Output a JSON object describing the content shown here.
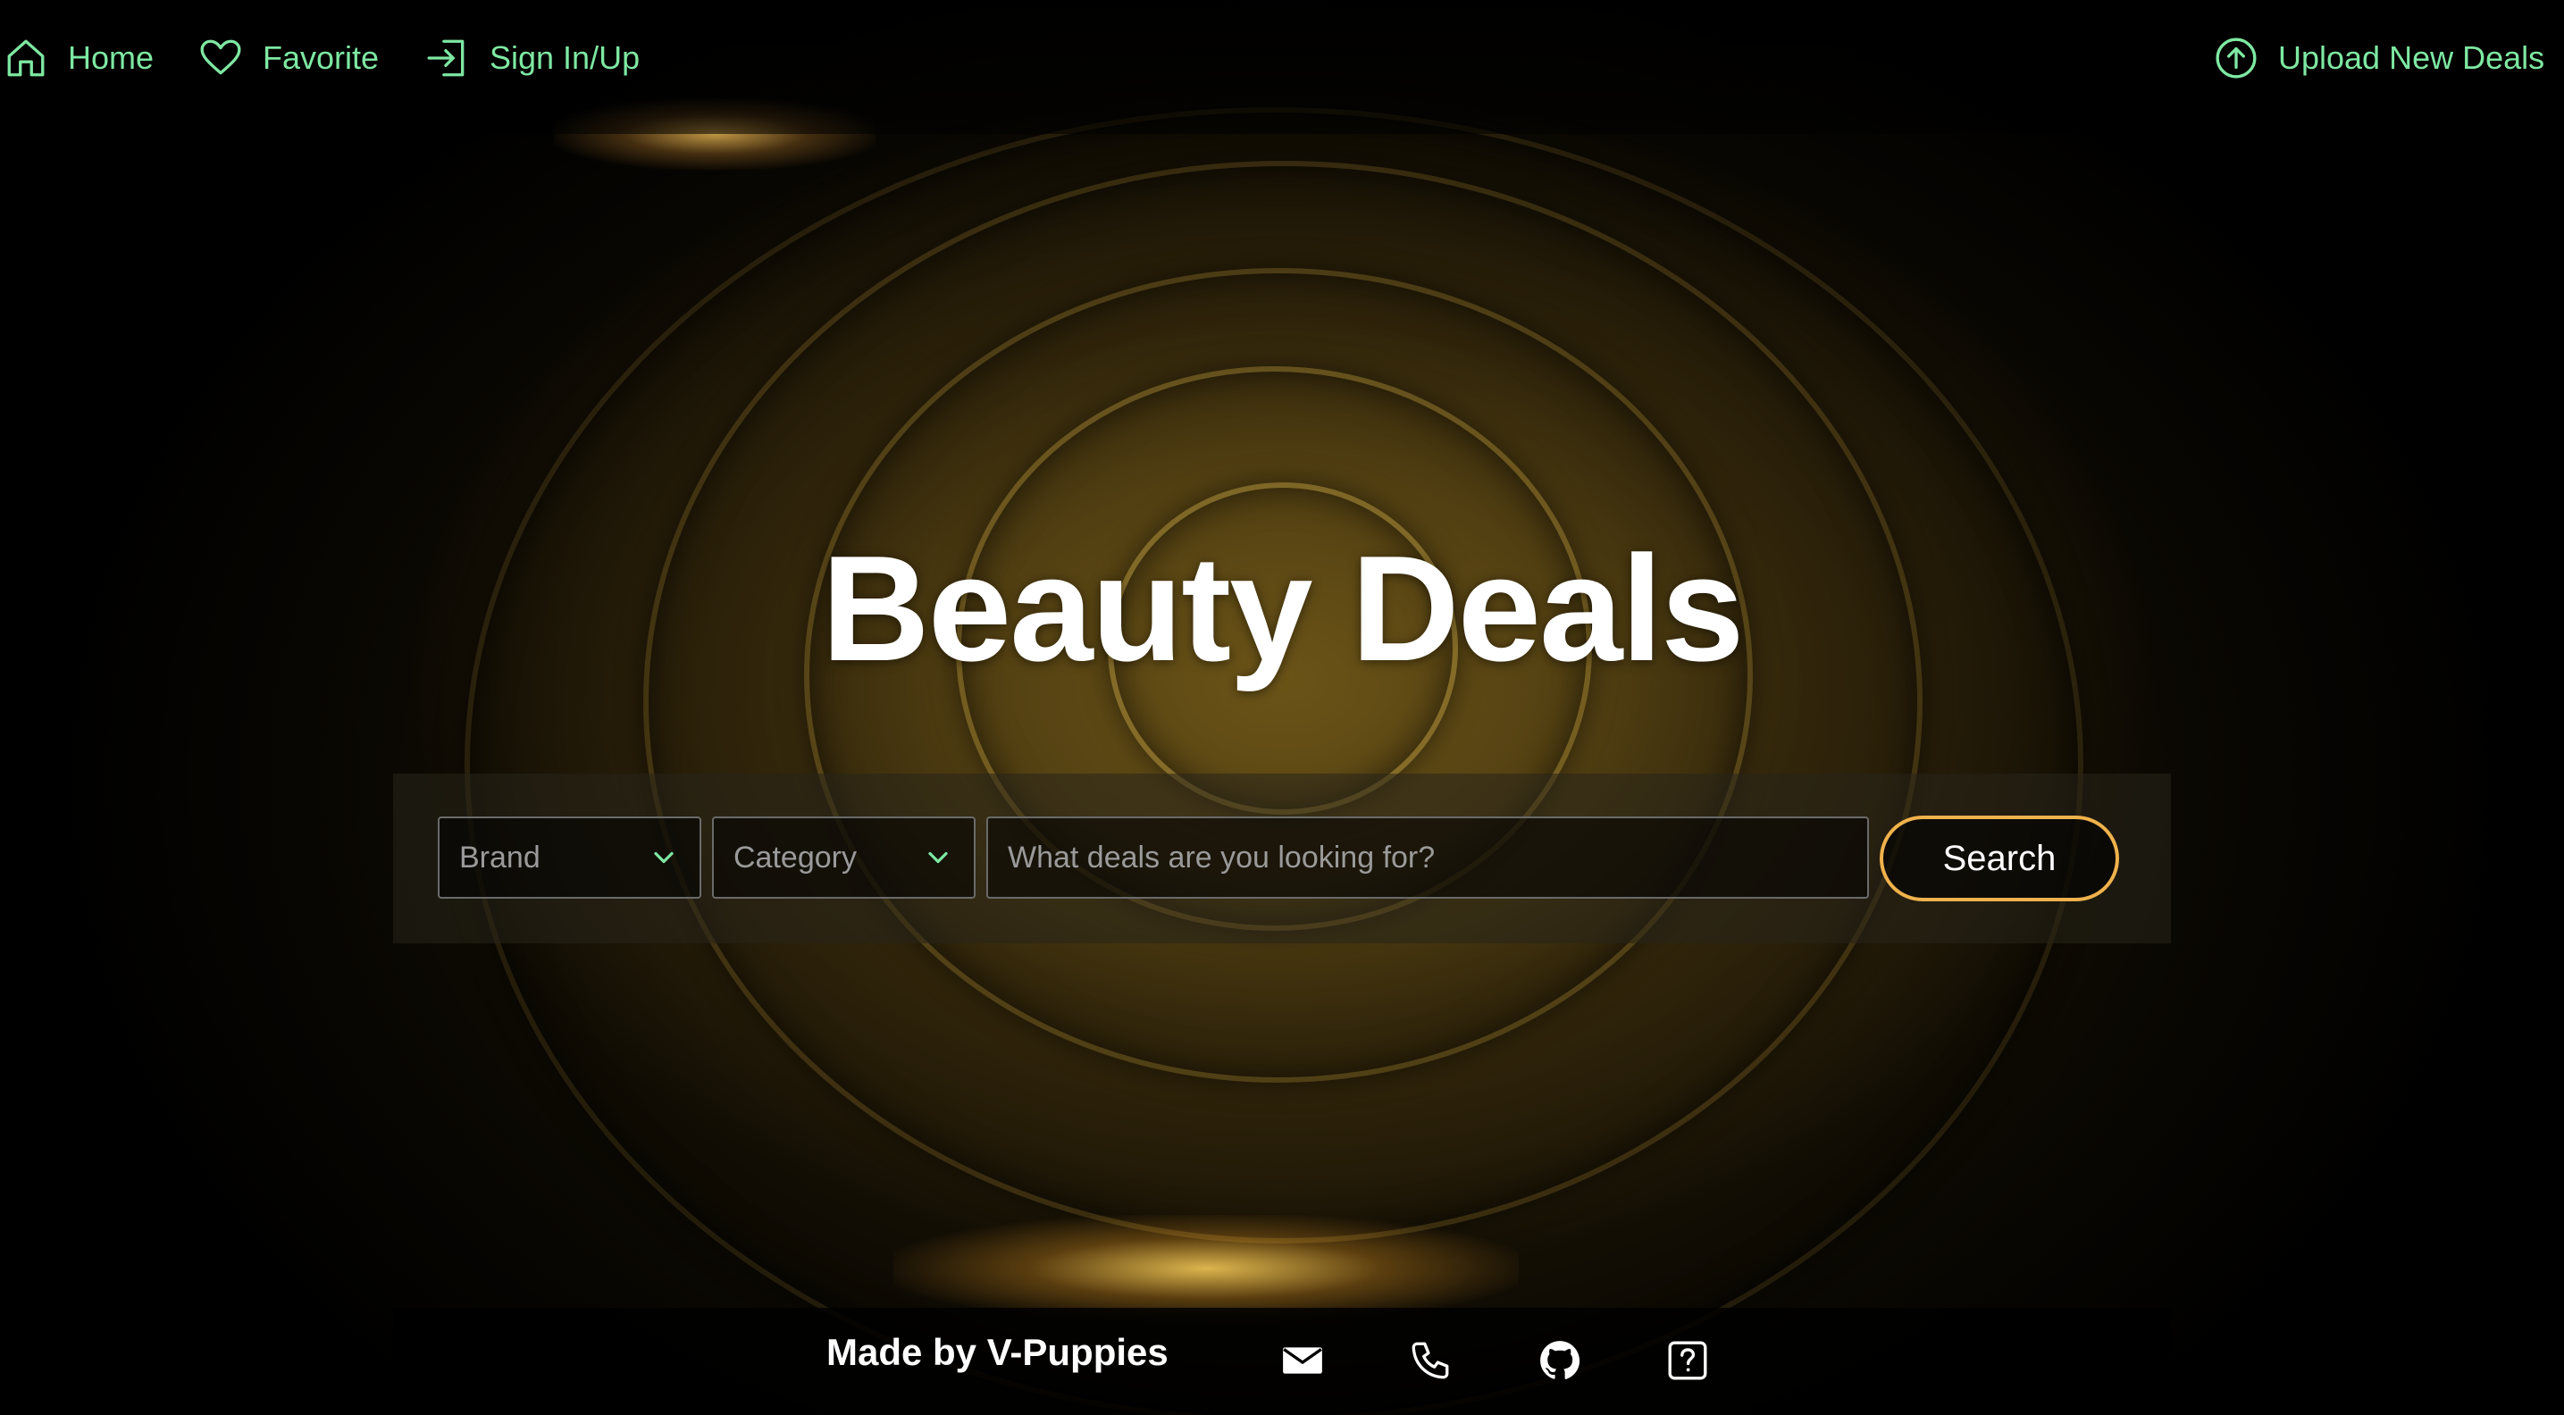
{
  "nav": {
    "home_label": "Home",
    "favorite_label": "Favorite",
    "signin_label": "Sign In/Up",
    "upload_label": "Upload New Deals",
    "icons": [
      "home-icon",
      "heart-icon",
      "sign-in-icon",
      "upload-icon"
    ],
    "accent_color": "#7ee8a2"
  },
  "hero": {
    "title": "Beauty Deals"
  },
  "search": {
    "brand_label": "Brand",
    "category_label": "Category",
    "placeholder": "What deals are you looking for?",
    "button_label": "Search",
    "button_border_color": "#f0b24c"
  },
  "footer": {
    "credit": "Made by V-Puppies",
    "icons": [
      "mail-icon",
      "phone-icon",
      "github-icon",
      "help-icon"
    ]
  }
}
